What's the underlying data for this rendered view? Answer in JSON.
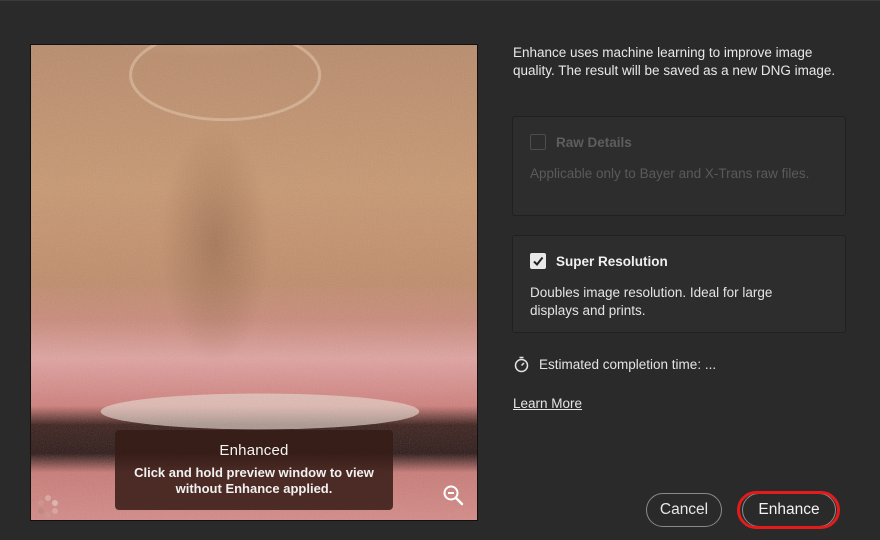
{
  "preview": {
    "overlay_title": "Enhanced",
    "overlay_body": "Click and hold preview window to view without Enhance applied.",
    "zoom_icon": "zoom-out-magnifier-icon",
    "loupe_icon": "loupe-dots-icon"
  },
  "panel": {
    "description": "Enhance uses machine learning to improve image quality. The result will be saved as a new DNG image.",
    "options": [
      {
        "label": "Raw Details",
        "checked": false,
        "disabled": true,
        "description": "Applicable only to Bayer and X-Trans raw files."
      },
      {
        "label": "Super Resolution",
        "checked": true,
        "disabled": false,
        "description": "Doubles image resolution. Ideal for large displays and prints."
      }
    ],
    "eta": {
      "icon": "stopwatch-icon",
      "label": "Estimated completion time: ..."
    },
    "learn_more": "Learn More"
  },
  "buttons": {
    "cancel": "Cancel",
    "enhance": "Enhance"
  },
  "colors": {
    "background": "#2a2a2a",
    "highlight": "#e31b1b",
    "overlay": "#371c16"
  }
}
